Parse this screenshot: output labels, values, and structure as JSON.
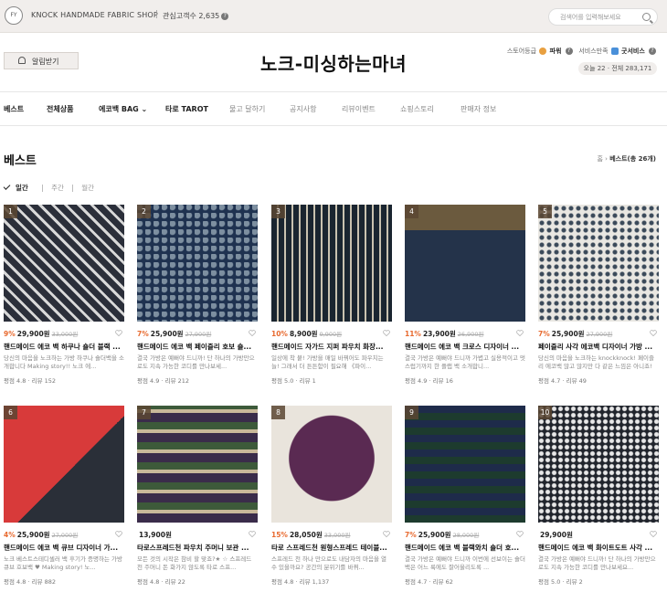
{
  "topbar": {
    "logo_text": "FY",
    "shop_name": "KNOCK HANDMADE FABRIC SHOP",
    "separator": "|",
    "fav_label": "관심고객수 2,635",
    "help": "?",
    "search_placeholder": "검색어를 입력해보세요"
  },
  "header": {
    "alert_label": "알림받기",
    "store_title": "노크-미싱하는마녀",
    "grade_label": "스토어등급",
    "grade_value": "파워",
    "service_label": "서비스만족",
    "service_value": "굿서비스",
    "visits": "오늘 22 · 전체 283,171"
  },
  "nav": {
    "items": [
      "베스트",
      "전체상품",
      "에코백 BAG",
      "타로 TAROT",
      "물고 달하기",
      "공지사항",
      "리뷰이벤트",
      "쇼핑스토리",
      "판매자 정보"
    ]
  },
  "page": {
    "title": "베스트",
    "crumb_home": "홈",
    "crumb_arrow": "›",
    "crumb_current": "베스트(총 26개)",
    "tabs": [
      "일간",
      "주간",
      "월간"
    ],
    "tab_sep": "|"
  },
  "products": [
    {
      "rank": "1",
      "discount": "9%",
      "price": "29,900원",
      "orig": "33,000원",
      "name": "핸드메이드 에코 백 하쿠나 숄더 블랙 ...",
      "desc": "당신의 마음을 노크하는 가방 하쿠나 숄더백을 소개합니다 Making story!! 노크 에...",
      "rating": "평점 4.8",
      "reviews": "리뷰 152",
      "colors": [
        "#2b2f3a",
        "#d8d8d8"
      ]
    },
    {
      "rank": "2",
      "discount": "7%",
      "price": "25,900원",
      "orig": "27,900원",
      "name": "핸드메이드 에코 백 페이즐리 호보 숄...",
      "desc": "결국 가방은 예뻐야 드니까! 단 하나의 가방만으로도 지속 가능한 코디를 만나보세...",
      "rating": "평점 4.9",
      "reviews": "리뷰 212",
      "colors": [
        "#1f3250",
        "#7d8fa0"
      ]
    },
    {
      "rank": "3",
      "discount": "10%",
      "price": "8,900원",
      "orig": "9,900원",
      "name": "핸드메이드 자가드 지퍼 파우치 화장...",
      "desc": "일상에 착 붙! 가방을 매일 바꿔어도 파우치는 늘! 그래서 더 튼튼함이 필요해 《파이...",
      "rating": "평점 5.0",
      "reviews": "리뷰 1",
      "colors": [
        "#1a2530",
        "#c9c2b0"
      ]
    },
    {
      "rank": "4",
      "discount": "11%",
      "price": "23,900원",
      "orig": "26,900원",
      "name": "핸드메이드 에코 백 크로스 디자이너 ...",
      "desc": "결국 가방은 예뻐야 드니까 가볍고 실용적이고 멋스럽기까지 한 플랩 백 소개합니...",
      "rating": "평점 4.9",
      "reviews": "리뷰 16",
      "colors": [
        "#24334a",
        "#e0dfdb"
      ]
    },
    {
      "rank": "5",
      "discount": "7%",
      "price": "25,900원",
      "orig": "27,900원",
      "name": "페이즐리 사각 에코백 디자이너 가방 ...",
      "desc": "당신의 마음을 노크하는 knockknock! 페이즐리 에코백 많고 많지만 다 같은 느낌은 아니죠! 아는 ...",
      "rating": "평점 4.7",
      "reviews": "리뷰 49",
      "colors": [
        "#e9e7e2",
        "#3b4a5a"
      ]
    },
    {
      "rank": "6",
      "discount": "4%",
      "price": "25,900원",
      "orig": "27,000원",
      "name": "핸드메이드 에코 백 큐브 디자이너 가...",
      "desc": "노크 베스트스테디셀러 백 후기가 증명하는 가방 큐브 호보백 ♥ Making story! 노...",
      "rating": "평점 4.8",
      "reviews": "리뷰 882",
      "colors": [
        "#d83a3a",
        "#2a2f38"
      ]
    },
    {
      "rank": "7",
      "discount": "",
      "price": "13,900원",
      "orig": "",
      "name": "타로스프레드천 파우치 주머니 보관 ...",
      "desc": "모든 것의 시작은 참비 할 맞죠?★ ☆ 스프레드 천 주머니 돈 화가지 않도록 타로 스프...",
      "rating": "평점 4.8",
      "reviews": "리뷰 22",
      "colors": [
        "#3a2c4a",
        "#c9b99a"
      ]
    },
    {
      "rank": "8",
      "discount": "15%",
      "price": "28,050원",
      "orig": "33,000원",
      "name": "타로 스프레드천 원형스프레드 테이블...",
      "desc": "스프레드 천 하나 만으로도 내담자의 마음을 열 수 있을까요? 공간의 분위기를 바꿔...",
      "rating": "평점 4.8",
      "reviews": "리뷰 1,137",
      "colors": [
        "#5a2a52",
        "#c7a57a"
      ]
    },
    {
      "rank": "9",
      "discount": "7%",
      "price": "25,900원",
      "orig": "28,000원",
      "name": "핸드메이드 에코 백 블랙와치 숄더 호...",
      "desc": "결국 가방은 예뻐야 드니까 이번에 선보이는 숄더백은 어느 룩에도 잘어울리도록 ...",
      "rating": "평점 4.7",
      "reviews": "리뷰 62",
      "colors": [
        "#1d3b2e",
        "#1e2b4a"
      ]
    },
    {
      "rank": "10",
      "discount": "",
      "price": "29,900원",
      "orig": "",
      "name": "핸드메이드 에코 백 화이트도트 사각 ...",
      "desc": "결국 가방은 예뻐야 드니까! 단 하나의 가방만으로도 지속 가능한 코디를 만나보세요...",
      "rating": "평점 5.0",
      "reviews": "리뷰 2",
      "colors": [
        "#20242c",
        "#e8e8e8"
      ]
    }
  ],
  "review_sep": "·",
  "colors": {
    "accent": "#e86a2f",
    "topbar": "#f1eeec"
  }
}
